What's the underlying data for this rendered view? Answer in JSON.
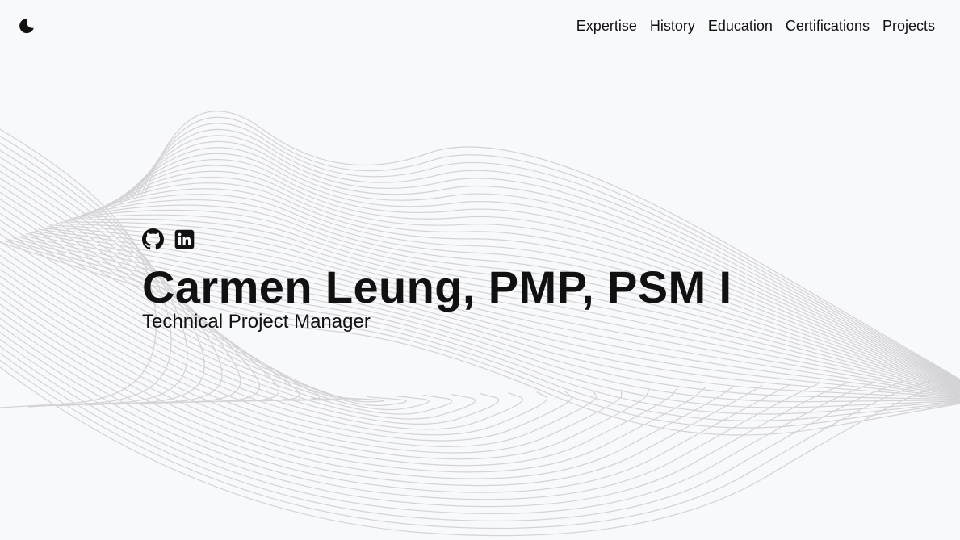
{
  "theme": {
    "background": "#f8f9fa",
    "text": "#111111",
    "wave_color": "#d3d3d6",
    "toggle_icon": "crescent-moon-icon"
  },
  "nav": {
    "items": [
      {
        "label": "Expertise"
      },
      {
        "label": "History"
      },
      {
        "label": "Education"
      },
      {
        "label": "Certifications"
      },
      {
        "label": "Projects"
      }
    ]
  },
  "hero": {
    "social": [
      {
        "icon": "github-icon"
      },
      {
        "icon": "linkedin-icon"
      }
    ],
    "name": "Carmen Leung, PMP, PSM I",
    "title": "Technical Project Manager"
  }
}
